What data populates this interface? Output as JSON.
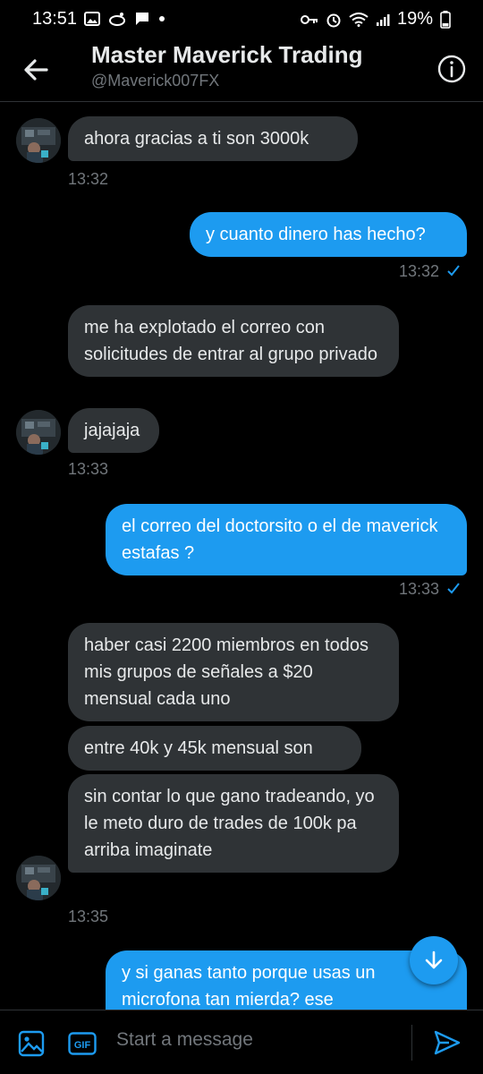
{
  "status": {
    "time": "13:51",
    "battery": "19%"
  },
  "header": {
    "title": "Master Maverick Trading",
    "handle": "@Maverick007FX"
  },
  "messages": [
    {
      "text": "ahora gracias a ti son 3000k",
      "time": "13:32"
    },
    {
      "text": "y cuanto dinero has hecho?",
      "time": "13:32"
    },
    {
      "text": "me ha explotado el correo con solicitudes de entrar al grupo privado"
    },
    {
      "text": "jajajaja",
      "time": "13:33"
    },
    {
      "text": "el correo del doctorsito o el de maverick estafas ?",
      "time": "13:33"
    },
    {
      "text": "haber casi 2200 miembros en todos mis grupos de señales a $20 mensual cada uno"
    },
    {
      "text": "entre 40k y 45k mensual son"
    },
    {
      "text": "sin contar lo que gano tradeando, yo le meto duro de trades de 100k pa arriba imaginate",
      "time": "13:35"
    },
    {
      "text": "y si ganas tanto porque usas un microfona tan mierda? ese"
    }
  ],
  "composer": {
    "placeholder": "Start a message"
  },
  "colors": {
    "accent": "#1d9bf0",
    "received_bubble": "#2f3336",
    "background": "#000000",
    "muted_text": "#71767b"
  },
  "icons": [
    "back-arrow-icon",
    "info-icon",
    "image-icon",
    "gif-icon",
    "send-icon",
    "scroll-down-icon",
    "read-check-icon"
  ]
}
